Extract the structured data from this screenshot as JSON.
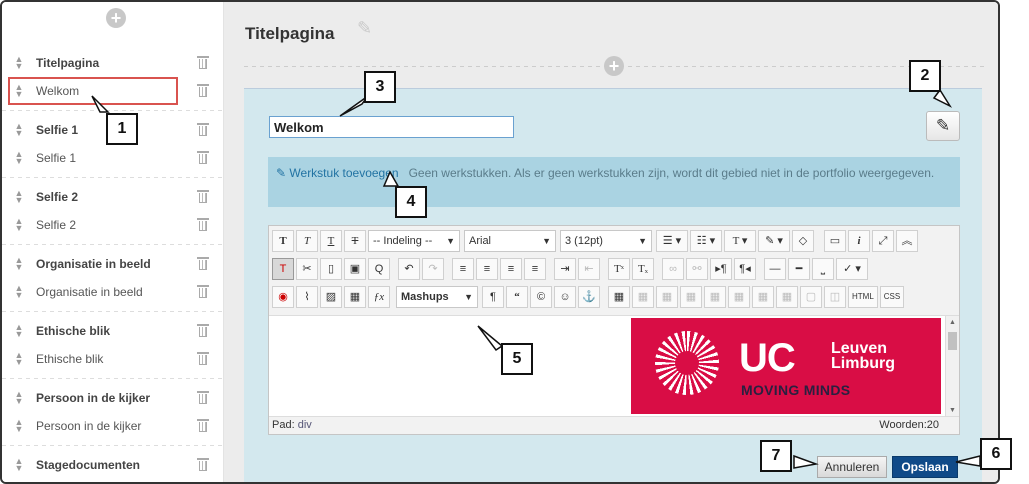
{
  "sidebar": {
    "items": [
      {
        "label": "Titelpagina",
        "bold": true
      },
      {
        "label": "Welkom",
        "bold": false
      },
      {
        "label": "Selfie 1",
        "bold": true
      },
      {
        "label": "Selfie 1",
        "bold": false
      },
      {
        "label": "Selfie 2",
        "bold": true
      },
      {
        "label": "Selfie 2",
        "bold": false
      },
      {
        "label": "Organisatie in beeld",
        "bold": true
      },
      {
        "label": "Organisatie in beeld",
        "bold": false
      },
      {
        "label": "Ethische blik",
        "bold": true
      },
      {
        "label": "Ethische blik",
        "bold": false
      },
      {
        "label": "Persoon in de kijker",
        "bold": true
      },
      {
        "label": "Persoon in de kijker",
        "bold": false
      },
      {
        "label": "Stagedocumenten",
        "bold": true
      }
    ]
  },
  "main": {
    "title": "Titelpagina",
    "title_input_value": "Welkom",
    "work": {
      "link": "Werkstuk toevoegen",
      "text": "Geen werkstukken. Als er geen werkstukken zijn, wordt dit gebied niet in de portfolio weergegeven."
    },
    "editor": {
      "format_dropdown": "-- Indeling --",
      "font_dropdown": "Arial",
      "size_dropdown": "3 (12pt)",
      "mashups_label": "Mashups",
      "html_label": "HTML",
      "css_label": "CSS",
      "path_label": "Pad:",
      "path_value": "div",
      "word_count": "Woorden:20"
    },
    "banner": {
      "uc": "UC",
      "leuven": "Leuven",
      "limburg": "Limburg",
      "tagline": "MOVING MINDS"
    },
    "buttons": {
      "cancel": "Annuleren",
      "save": "Opslaan"
    }
  },
  "callouts": [
    "1",
    "2",
    "3",
    "4",
    "5",
    "6",
    "7"
  ],
  "colors": {
    "panel": "#d3e8ee",
    "work_bar": "#aad3e2",
    "save": "#0f4a88",
    "highlight": "#d9534f",
    "banner": "#d90d45"
  }
}
